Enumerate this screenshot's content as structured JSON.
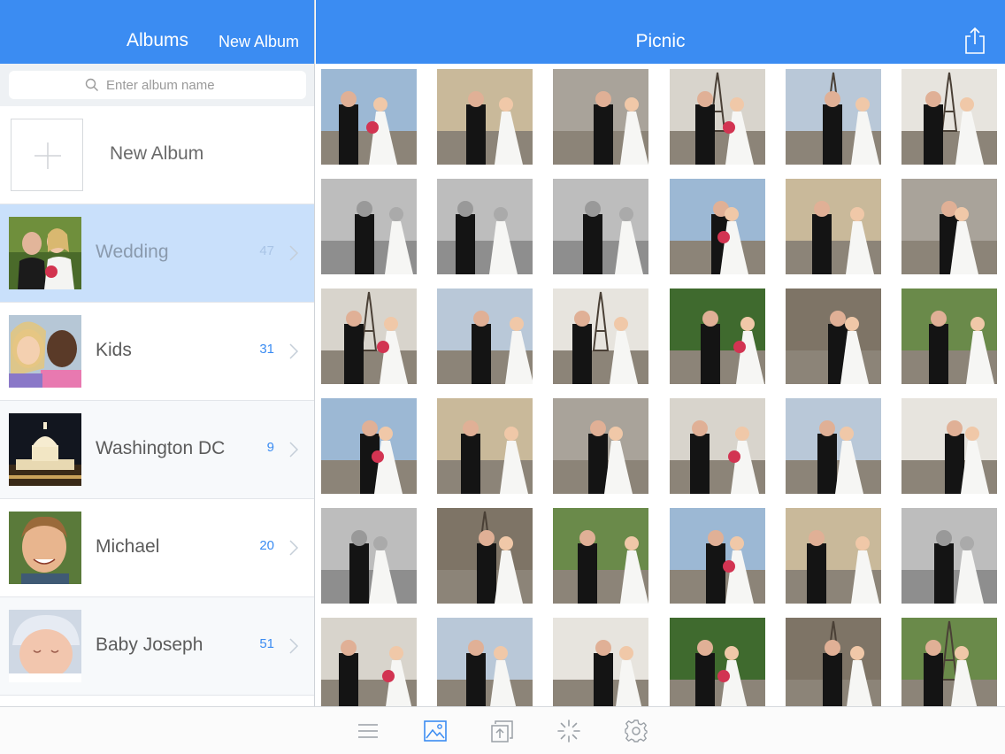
{
  "sidebar": {
    "title": "Albums",
    "new_album_link": "New Album",
    "search": {
      "placeholder": "Enter album name",
      "value": ""
    },
    "new_album_row_label": "New Album",
    "albums": [
      {
        "name": "Wedding",
        "count": "47",
        "selected": true
      },
      {
        "name": "Kids",
        "count": "31",
        "selected": false
      },
      {
        "name": "Washington DC",
        "count": "9",
        "selected": false
      },
      {
        "name": "Michael",
        "count": "20",
        "selected": false
      },
      {
        "name": "Baby Joseph",
        "count": "51",
        "selected": false
      }
    ]
  },
  "main": {
    "title": "Picnic",
    "photo_count": 36
  },
  "tabbar": {
    "tabs": [
      {
        "icon": "list-icon",
        "active": false
      },
      {
        "icon": "photo-icon",
        "active": true
      },
      {
        "icon": "import-icon",
        "active": false
      },
      {
        "icon": "spinner-icon",
        "active": false
      },
      {
        "icon": "gear-icon",
        "active": false
      }
    ]
  },
  "colors": {
    "accent": "#3b8cf2",
    "selected_row": "#c9e0fb",
    "inactive_icon": "#9aa0a6"
  }
}
